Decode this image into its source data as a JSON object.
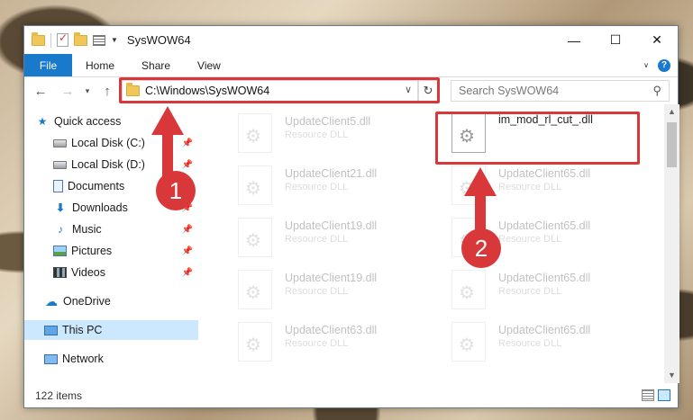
{
  "window": {
    "title": "SysWOW64",
    "controls": {
      "minimize": "—",
      "maximize": "☐",
      "close": "✕"
    }
  },
  "ribbon": {
    "tabs": [
      {
        "label": "File"
      },
      {
        "label": "Home"
      },
      {
        "label": "Share"
      },
      {
        "label": "View"
      }
    ],
    "accent": "#1979ca"
  },
  "navbar": {
    "address": "C:\\Windows\\SysWOW64",
    "search_placeholder": "Search SysWOW64"
  },
  "navpane": {
    "items": [
      {
        "label": "Quick access",
        "icon": "star-icon",
        "pinned": false
      },
      {
        "label": "Local Disk (C:)",
        "icon": "drive-icon",
        "pinned": true
      },
      {
        "label": "Local Disk (D:)",
        "icon": "drive-icon",
        "pinned": true
      },
      {
        "label": "Documents",
        "icon": "documents-icon",
        "pinned": true
      },
      {
        "label": "Downloads",
        "icon": "download-icon",
        "pinned": true
      },
      {
        "label": "Music",
        "icon": "music-icon",
        "pinned": true
      },
      {
        "label": "Pictures",
        "icon": "pictures-icon",
        "pinned": true
      },
      {
        "label": "Videos",
        "icon": "videos-icon",
        "pinned": true
      },
      {
        "label": "OneDrive",
        "icon": "cloud-icon",
        "pinned": false
      },
      {
        "label": "This PC",
        "icon": "computer-icon",
        "pinned": false,
        "selected": true
      },
      {
        "label": "Network",
        "icon": "network-icon",
        "pinned": false
      }
    ]
  },
  "files": {
    "highlighted": {
      "name": "im_mod_rl_cut_.dll"
    },
    "left_column": [
      {
        "name": "UpdateClient5.dll",
        "type": "Resource DLL"
      },
      {
        "name": "UpdateClient21.dll",
        "type": "Resource DLL"
      },
      {
        "name": "UpdateClient19.dll",
        "type": "Resource DLL"
      },
      {
        "name": "UpdateClient19.dll",
        "type": "Resource DLL"
      },
      {
        "name": "UpdateClient63.dll",
        "type": "Resource DLL"
      }
    ],
    "right_column": [
      {
        "name": "UpdateClient65.dll",
        "type": "Resource DLL"
      },
      {
        "name": "UpdateClient65.dll",
        "type": "Resource DLL"
      },
      {
        "name": "UpdateClient65.dll",
        "type": "Resource DLL"
      },
      {
        "name": "UpdateClient65.dll",
        "type": "Resource DLL"
      }
    ]
  },
  "status": {
    "item_count": "122 items"
  },
  "annotations": [
    {
      "number": "1",
      "color": "#d9383a"
    },
    {
      "number": "2",
      "color": "#d9383a"
    }
  ]
}
